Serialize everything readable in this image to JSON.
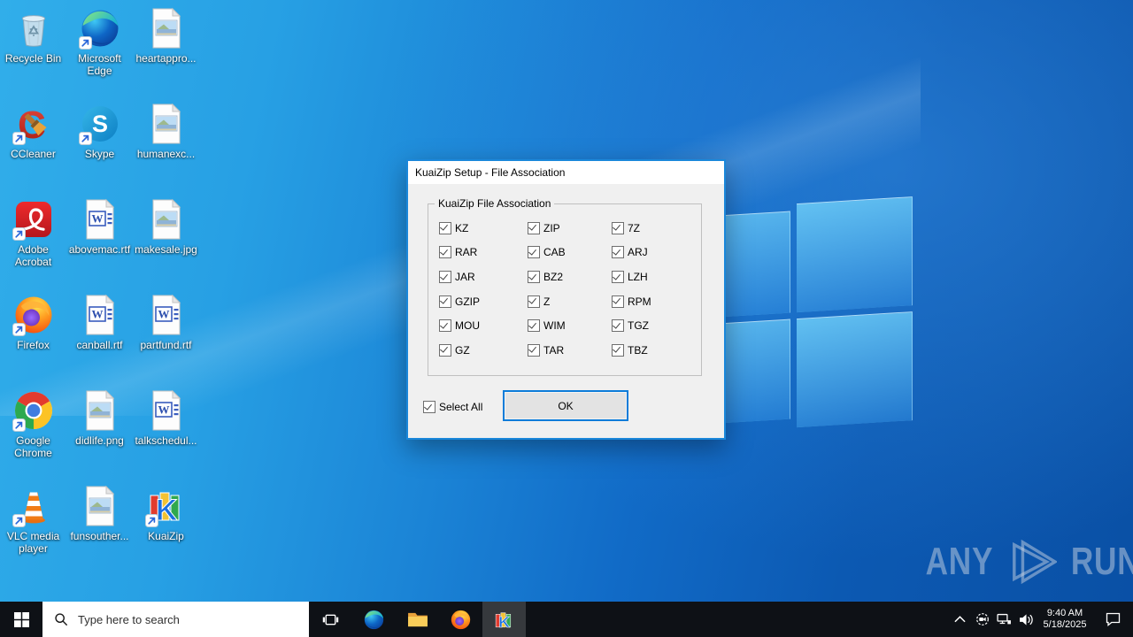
{
  "desktop": {
    "icons": [
      {
        "label": "Recycle Bin",
        "icon": "recycle-bin",
        "shortcut": false
      },
      {
        "label": "Microsoft Edge",
        "icon": "edge",
        "shortcut": true
      },
      {
        "label": "heartappro...",
        "icon": "image-file",
        "shortcut": false
      },
      {
        "label": "CCleaner",
        "icon": "ccleaner",
        "shortcut": true
      },
      {
        "label": "Skype",
        "icon": "skype",
        "shortcut": true
      },
      {
        "label": "humanexc...",
        "icon": "image-file",
        "shortcut": false
      },
      {
        "label": "Adobe Acrobat",
        "icon": "acrobat",
        "shortcut": true
      },
      {
        "label": "abovemac.rtf",
        "icon": "word-file",
        "shortcut": false
      },
      {
        "label": "makesale.jpg",
        "icon": "image-file",
        "shortcut": false
      },
      {
        "label": "Firefox",
        "icon": "firefox",
        "shortcut": true
      },
      {
        "label": "canball.rtf",
        "icon": "word-file",
        "shortcut": false
      },
      {
        "label": "partfund.rtf",
        "icon": "word-file",
        "shortcut": false
      },
      {
        "label": "Google Chrome",
        "icon": "chrome",
        "shortcut": true
      },
      {
        "label": "didlife.png",
        "icon": "image-file",
        "shortcut": false
      },
      {
        "label": "talkschedul...",
        "icon": "word-file",
        "shortcut": false
      },
      {
        "label": "VLC media player",
        "icon": "vlc",
        "shortcut": true
      },
      {
        "label": "funsouther...",
        "icon": "image-file",
        "shortcut": false
      },
      {
        "label": "KuaiZip",
        "icon": "kuaizip",
        "shortcut": true
      }
    ]
  },
  "dialog": {
    "title": "KuaiZip Setup - File Association",
    "group_label": "KuaiZip File Association",
    "checkboxes": [
      "KZ",
      "ZIP",
      "7Z",
      "RAR",
      "CAB",
      "ARJ",
      "JAR",
      "BZ2",
      "LZH",
      "GZIP",
      "Z",
      "RPM",
      "MOU",
      "WIM",
      "TGZ",
      "GZ",
      "TAR",
      "TBZ"
    ],
    "all_checked": true,
    "select_all_label": "Select All",
    "ok_label": "OK"
  },
  "taskbar": {
    "search_placeholder": "Type here to search",
    "buttons": [
      "start",
      "search",
      "task-view",
      "edge",
      "file-explorer",
      "firefox",
      "kuaizip-setup"
    ],
    "active_button": "kuaizip-setup",
    "tray_icons": [
      "tray-chevron",
      "meet-now",
      "network",
      "volume",
      "clock",
      "action-center"
    ],
    "tray": {
      "time": "9:40 AM",
      "date": "5/18/2025"
    }
  },
  "watermark": {
    "any": "ANY",
    "run": "RUN"
  },
  "colors": {
    "accent": "#0078d7",
    "dialog_border": "#1a87da",
    "taskbar_bg": "#0e1116",
    "dialog_bg": "#f0f0f0",
    "wallpaper_light": "#31aeea",
    "wallpaper_dark": "#0a50a5"
  }
}
